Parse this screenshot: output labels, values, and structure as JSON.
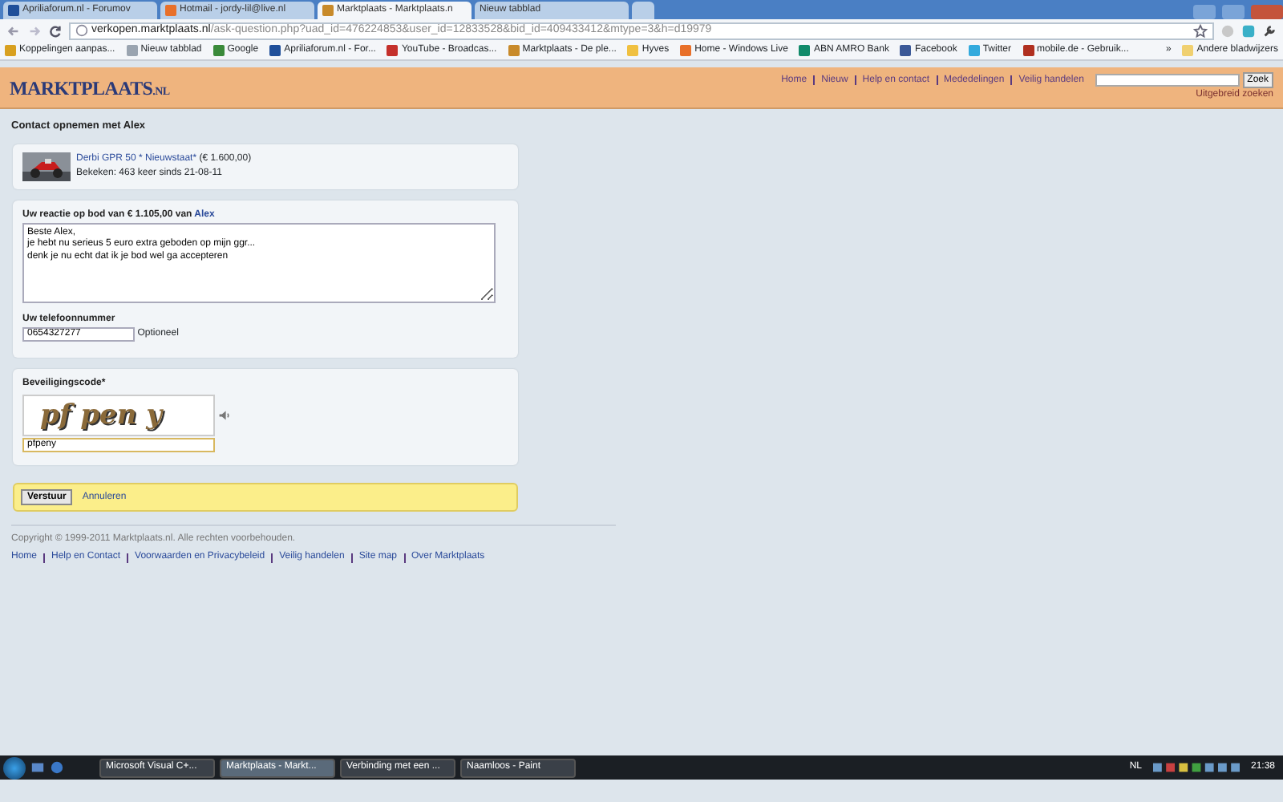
{
  "browser": {
    "tabs": [
      {
        "label": "Apriliaforum.nl - Forumov",
        "selected": false,
        "color": "#1f4f9a"
      },
      {
        "label": "Hotmail - jordy-lil@live.nl",
        "selected": false,
        "color": "#e8702a"
      },
      {
        "label": "Marktplaats - Marktplaats.n",
        "selected": true,
        "color": "#c88a2a"
      },
      {
        "label": "Nieuw tabblad",
        "selected": false
      }
    ],
    "url_host": "verkopen.marktplaats.nl",
    "url_path": "/ask-question.php?uad_id=476224853&user_id=12833528&bid_id=409433412&mtype=3&h=d19979",
    "bookmarks": [
      {
        "label": "Koppelingen aanpas...",
        "color": "#d8a020"
      },
      {
        "label": "Nieuw tabblad",
        "color": "#9aa4b0"
      },
      {
        "label": "Google",
        "color": "#3a8a3a"
      },
      {
        "label": "Apriliaforum.nl - For...",
        "color": "#1f4f9a"
      },
      {
        "label": "YouTube - Broadcas...",
        "color": "#c4302b"
      },
      {
        "label": "Marktplaats - De ple...",
        "color": "#c88a2a"
      },
      {
        "label": "Hyves",
        "color": "#f0c040"
      },
      {
        "label": "Home - Windows Live",
        "color": "#e8702a"
      },
      {
        "label": "ABN AMRO Bank",
        "color": "#118a6a"
      },
      {
        "label": "Facebook",
        "color": "#3b5998"
      },
      {
        "label": "Twitter",
        "color": "#33aadd"
      },
      {
        "label": "mobile.de - Gebruik...",
        "color": "#b03020"
      }
    ],
    "more": "»",
    "other_bookmarks": "Andere bladwijzers"
  },
  "site": {
    "logo": "MARKTPLAATS",
    "logo_suffix": ".NL",
    "nav": [
      "Home",
      "Nieuw",
      "Help en contact",
      "Mededelingen",
      "Veilig handelen"
    ],
    "search_button": "Zoek",
    "advanced": "Uitgebreid zoeken"
  },
  "heading": "Contact opnemen met Alex",
  "listing": {
    "title": "Derbi GPR 50 * Nieuwstaat*",
    "price": "(€ 1.600,00)",
    "views": "Bekeken: 463 keer sinds 21-08-11"
  },
  "reply": {
    "label": "Uw reactie op bod van € 1.105,00 van ",
    "name": "Alex",
    "message": "Beste Alex,\nje hebt nu serieus 5 euro extra geboden op mijn ggr...\ndenk je nu echt dat ik je bod wel ga accepteren",
    "phone_label": "Uw telefoonnummer",
    "phone": "0654327277",
    "optional": "Optioneel"
  },
  "security": {
    "label": "Beveiligingscode*",
    "captcha": "pf pen y",
    "code": "pfpeny"
  },
  "actions": {
    "submit": "Verstuur",
    "cancel": "Annuleren"
  },
  "footer": {
    "copyright": "Copyright © 1999-2011 Marktplaats.nl. Alle rechten voorbehouden.",
    "links": [
      "Home",
      "Help en Contact",
      "Voorwaarden en Privacybeleid",
      "Veilig handelen",
      "Site map",
      "Over Marktplaats"
    ]
  },
  "taskbar": {
    "items": [
      {
        "label": "Microsoft Visual C+...",
        "selected": false
      },
      {
        "label": "Marktplaats - Markt...",
        "selected": true
      },
      {
        "label": "Verbinding met een ...",
        "selected": false
      },
      {
        "label": "Naamloos - Paint",
        "selected": false
      }
    ],
    "language": "NL",
    "time": "21:38"
  }
}
